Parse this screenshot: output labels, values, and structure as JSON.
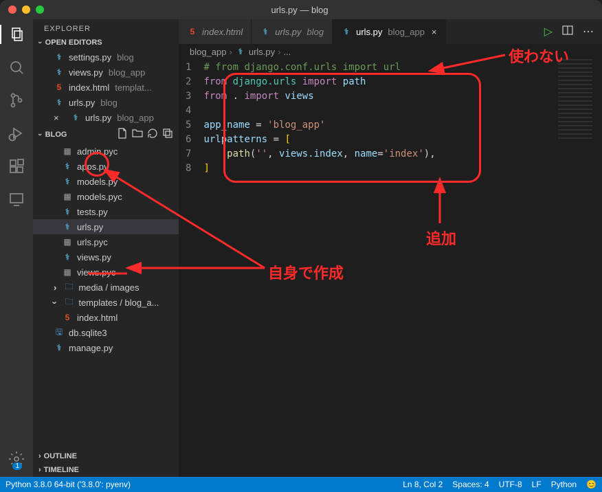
{
  "window": {
    "title": "urls.py — blog"
  },
  "activity": {
    "badge": "1"
  },
  "sidebar": {
    "title": "EXPLORER",
    "open_editors_label": "OPEN EDITORS",
    "open_editors": [
      {
        "name": "settings.py",
        "dim": "blog",
        "icon": "py"
      },
      {
        "name": "views.py",
        "dim": "blog_app",
        "icon": "py"
      },
      {
        "name": "index.html",
        "dim": "templat...",
        "icon": "html"
      },
      {
        "name": "urls.py",
        "dim": "blog",
        "icon": "py"
      },
      {
        "name": "urls.py",
        "dim": "blog_app",
        "icon": "py",
        "close": true
      }
    ],
    "root_label": "BLOG",
    "files": [
      {
        "name": "admin.pyc",
        "icon": "pyc",
        "indent": 2
      },
      {
        "name": "apps.py",
        "icon": "py",
        "indent": 2
      },
      {
        "name": "models.py",
        "icon": "py",
        "indent": 2
      },
      {
        "name": "models.pyc",
        "icon": "pyc",
        "indent": 2
      },
      {
        "name": "tests.py",
        "icon": "py",
        "indent": 2
      },
      {
        "name": "urls.py",
        "icon": "py",
        "indent": 2,
        "active": true
      },
      {
        "name": "urls.pyc",
        "icon": "pyc",
        "indent": 2
      },
      {
        "name": "views.py",
        "icon": "py",
        "indent": 2
      },
      {
        "name": "views.pyc",
        "icon": "pyc",
        "indent": 2
      },
      {
        "name": "media / images",
        "icon": "folder",
        "indent": 1,
        "chev": "right"
      },
      {
        "name": "templates / blog_a...",
        "icon": "folder",
        "indent": 1,
        "chev": "down"
      },
      {
        "name": "index.html",
        "icon": "html",
        "indent": 2
      },
      {
        "name": "db.sqlite3",
        "icon": "db",
        "indent": 1
      },
      {
        "name": "manage.py",
        "icon": "py",
        "indent": 1
      }
    ],
    "outline_label": "OUTLINE",
    "timeline_label": "TIMELINE"
  },
  "tabs": {
    "items": [
      {
        "name": "index.html",
        "icon": "html"
      },
      {
        "name": "urls.py",
        "dim": "blog",
        "icon": "py"
      },
      {
        "name": "urls.py",
        "dim": "blog_app",
        "icon": "py",
        "active": true,
        "close": true
      }
    ]
  },
  "breadcrumb": {
    "seg1": "blog_app",
    "seg2": "urls.py",
    "seg3": "..."
  },
  "code": {
    "lines": [
      "1",
      "2",
      "3",
      "4",
      "5",
      "6",
      "7",
      "8"
    ],
    "l1_comment": "# from django.conf.urls import url",
    "l2_from": "from",
    "l2_mod": "django.urls",
    "l2_imp": "import",
    "l2_name": "path",
    "l3_from": "from",
    "l3_dot": ".",
    "l3_imp": "import",
    "l3_name": "views",
    "l5_var": "app_name",
    "l5_eq": " = ",
    "l5_str": "'blog_app'",
    "l6_var": "urlpatterns",
    "l6_eq": " = ",
    "l6_br": "[",
    "l7_func": "path",
    "l7_p1": "(",
    "l7_s1": "''",
    "l7_c1": ", ",
    "l7_v1": "views.index",
    "l7_c2": ", ",
    "l7_kw": "name",
    "l7_eq": "=",
    "l7_s2": "'index'",
    "l7_p2": "),",
    "l8_br": "]",
    "indent": "    "
  },
  "status": {
    "interpreter": "Python 3.8.0 64-bit ('3.8.0': pyenv)",
    "pos": "Ln 8, Col 2",
    "spaces": "Spaces: 4",
    "enc": "UTF-8",
    "eol": "LF",
    "lang": "Python",
    "feedback": "😊"
  },
  "annotations": {
    "not_used": "使わない",
    "added": "追加",
    "self_create": "自身で作成"
  }
}
